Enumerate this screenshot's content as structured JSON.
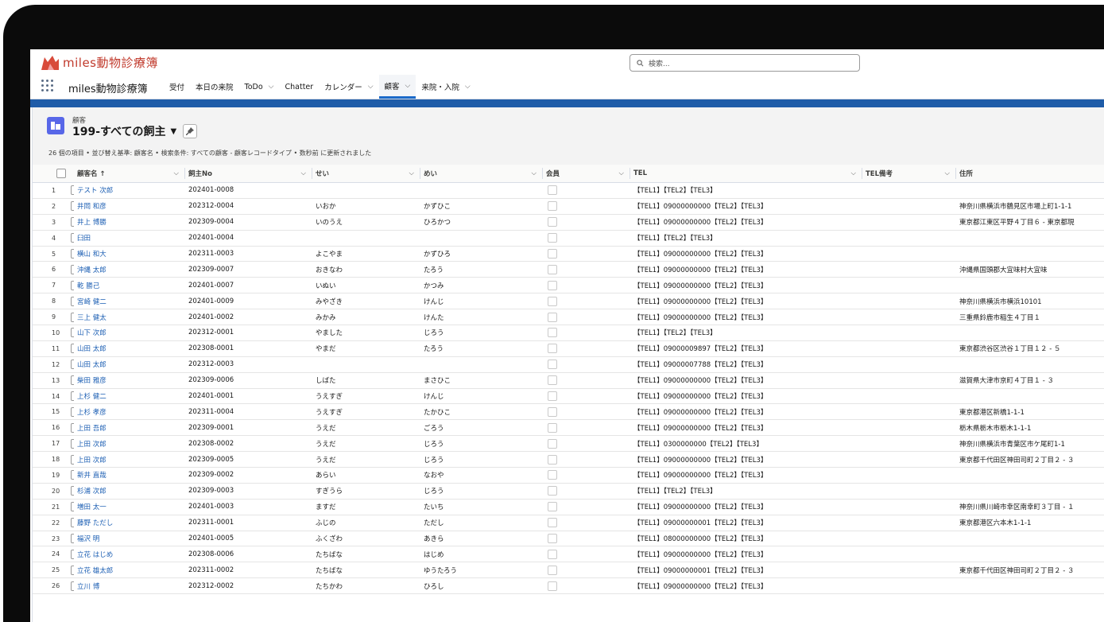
{
  "app": {
    "logo_text": "miles動物診療簿",
    "search_placeholder": "検索...",
    "app_name": "miles動物診療簿",
    "nav": [
      {
        "label": "受付",
        "dropdown": false,
        "active": false
      },
      {
        "label": "本日の来院",
        "dropdown": false,
        "active": false
      },
      {
        "label": "ToDo",
        "dropdown": true,
        "active": false
      },
      {
        "label": "Chatter",
        "dropdown": false,
        "active": false
      },
      {
        "label": "カレンダー",
        "dropdown": true,
        "active": false
      },
      {
        "label": "顧客",
        "dropdown": true,
        "active": true
      },
      {
        "label": "来院・入院",
        "dropdown": true,
        "active": false
      }
    ]
  },
  "list": {
    "object_label": "顧客",
    "view_name": "199-すべての飼主",
    "summary": "26 個の項目 • 並び替え基準: 顧客名 • 検索条件: すべての顧客 - 顧客レコードタイプ • 数秒前 に更新されました",
    "columns": {
      "name": "顧客名 ↑",
      "no": "飼主No",
      "sei": "せい",
      "mei": "めい",
      "member": "会員",
      "tel": "TEL",
      "telnote": "TEL備考",
      "address": "住所"
    },
    "rows": [
      {
        "n": "1",
        "name": "テスト 次郎",
        "no": "202401-0008",
        "sei": "",
        "mei": "",
        "tel": "【TEL1】【TEL2】【TEL3】",
        "addr": ""
      },
      {
        "n": "2",
        "name": "井岡 和彦",
        "no": "202312-0004",
        "sei": "いおか",
        "mei": "かずひこ",
        "tel": "【TEL1】09000000000【TEL2】【TEL3】",
        "addr": "神奈川県横浜市鶴見区市場上町1-1-1"
      },
      {
        "n": "3",
        "name": "井上 博勝",
        "no": "202309-0004",
        "sei": "いのうえ",
        "mei": "ひろかつ",
        "tel": "【TEL1】09000000000【TEL2】【TEL3】",
        "addr": "東京都江東区平野４丁目６ - 東京都現"
      },
      {
        "n": "4",
        "name": "臼田",
        "no": "202401-0004",
        "sei": "",
        "mei": "",
        "tel": "【TEL1】【TEL2】【TEL3】",
        "addr": ""
      },
      {
        "n": "5",
        "name": "横山 和大",
        "no": "202311-0003",
        "sei": "よこやま",
        "mei": "かずひろ",
        "tel": "【TEL1】09000000000【TEL2】【TEL3】",
        "addr": ""
      },
      {
        "n": "6",
        "name": "沖縄 太郎",
        "no": "202309-0007",
        "sei": "おきなわ",
        "mei": "たろう",
        "tel": "【TEL1】09000000000【TEL2】【TEL3】",
        "addr": "沖縄県国頭郡大宜味村大宜味"
      },
      {
        "n": "7",
        "name": "乾 勝己",
        "no": "202401-0007",
        "sei": "いぬい",
        "mei": "かつみ",
        "tel": "【TEL1】09000000000【TEL2】【TEL3】",
        "addr": ""
      },
      {
        "n": "8",
        "name": "宮崎 健二",
        "no": "202401-0009",
        "sei": "みやざき",
        "mei": "けんじ",
        "tel": "【TEL1】09000000000【TEL2】【TEL3】",
        "addr": "神奈川県横浜市横浜10101"
      },
      {
        "n": "9",
        "name": "三上 健太",
        "no": "202401-0002",
        "sei": "みかみ",
        "mei": "けんた",
        "tel": "【TEL1】09000000000【TEL2】【TEL3】",
        "addr": "三重県鈴鹿市稲生４丁目１"
      },
      {
        "n": "10",
        "name": "山下 次郎",
        "no": "202312-0001",
        "sei": "やました",
        "mei": "じろう",
        "tel": "【TEL1】【TEL2】【TEL3】",
        "addr": ""
      },
      {
        "n": "11",
        "name": "山田 太郎",
        "no": "202308-0001",
        "sei": "やまだ",
        "mei": "たろう",
        "tel": "【TEL1】09000009897【TEL2】【TEL3】",
        "addr": "東京都渋谷区渋谷１丁目１２ - ５"
      },
      {
        "n": "12",
        "name": "山田 太郎",
        "no": "202312-0003",
        "sei": "",
        "mei": "",
        "tel": "【TEL1】09000007788【TEL2】【TEL3】",
        "addr": ""
      },
      {
        "n": "13",
        "name": "柴田 雅彦",
        "no": "202309-0006",
        "sei": "しばた",
        "mei": "まさひこ",
        "tel": "【TEL1】09000000000【TEL2】【TEL3】",
        "addr": "滋賀県大津市京町４丁目１ - ３"
      },
      {
        "n": "14",
        "name": "上杉 健二",
        "no": "202401-0001",
        "sei": "うえすぎ",
        "mei": "けんじ",
        "tel": "【TEL1】09000000000【TEL2】【TEL3】",
        "addr": ""
      },
      {
        "n": "15",
        "name": "上杉 孝彦",
        "no": "202311-0004",
        "sei": "うえすぎ",
        "mei": "たかひこ",
        "tel": "【TEL1】09000000000【TEL2】【TEL3】",
        "addr": "東京都港区新橋1-1-1"
      },
      {
        "n": "16",
        "name": "上田 吾郎",
        "no": "202309-0001",
        "sei": "うえだ",
        "mei": "ごろう",
        "tel": "【TEL1】09000000000【TEL2】【TEL3】",
        "addr": "栃木県栃木市栃木1-1-1"
      },
      {
        "n": "17",
        "name": "上田 次郎",
        "no": "202308-0002",
        "sei": "うえだ",
        "mei": "じろう",
        "tel": "【TEL1】0300000000【TEL2】【TEL3】",
        "addr": "神奈川県横浜市青葉区市ケ尾町1-1"
      },
      {
        "n": "18",
        "name": "上田 次郎",
        "no": "202309-0005",
        "sei": "うえだ",
        "mei": "じろう",
        "tel": "【TEL1】09000000000【TEL2】【TEL3】",
        "addr": "東京都千代田区神田司町２丁目２ - ３"
      },
      {
        "n": "19",
        "name": "新井 直哉",
        "no": "202309-0002",
        "sei": "あらい",
        "mei": "なおや",
        "tel": "【TEL1】09000000000【TEL2】【TEL3】",
        "addr": ""
      },
      {
        "n": "20",
        "name": "杉浦 次郎",
        "no": "202309-0003",
        "sei": "すぎうら",
        "mei": "じろう",
        "tel": "【TEL1】【TEL2】【TEL3】",
        "addr": ""
      },
      {
        "n": "21",
        "name": "増田 太一",
        "no": "202401-0003",
        "sei": "ますだ",
        "mei": "たいち",
        "tel": "【TEL1】09000000000【TEL2】【TEL3】",
        "addr": "神奈川県川崎市幸区南幸町３丁目 - １"
      },
      {
        "n": "22",
        "name": "藤野 ただし",
        "no": "202311-0001",
        "sei": "ふじの",
        "mei": "ただし",
        "tel": "【TEL1】09000000001【TEL2】【TEL3】",
        "addr": "東京都港区六本木1-1-1"
      },
      {
        "n": "23",
        "name": "福沢 明",
        "no": "202401-0005",
        "sei": "ふくざわ",
        "mei": "あきら",
        "tel": "【TEL1】08000000000【TEL2】【TEL3】",
        "addr": ""
      },
      {
        "n": "24",
        "name": "立花 はじめ",
        "no": "202308-0006",
        "sei": "たちばな",
        "mei": "はじめ",
        "tel": "【TEL1】09000000000【TEL2】【TEL3】",
        "addr": ""
      },
      {
        "n": "25",
        "name": "立花 雄太郎",
        "no": "202311-0002",
        "sei": "たちばな",
        "mei": "ゆうたろう",
        "tel": "【TEL1】09000000001【TEL2】【TEL3】",
        "addr": "東京都千代田区神田司町２丁目２ - ３"
      },
      {
        "n": "26",
        "name": "立川 博",
        "no": "202312-0002",
        "sei": "たちかわ",
        "mei": "ひろし",
        "tel": "【TEL1】09000000000【TEL2】【TEL3】",
        "addr": ""
      }
    ]
  },
  "colors": {
    "link": "#1b5eb3",
    "brand": "#c0392b",
    "banner": "#1f5ca8",
    "object_icon": "#5867e8"
  },
  "icons": [
    "cat-logo-icon",
    "search-icon",
    "app-launcher-icon",
    "chevron-down-icon",
    "list-view-icon",
    "pin-icon",
    "sort-arrow-icon"
  ]
}
